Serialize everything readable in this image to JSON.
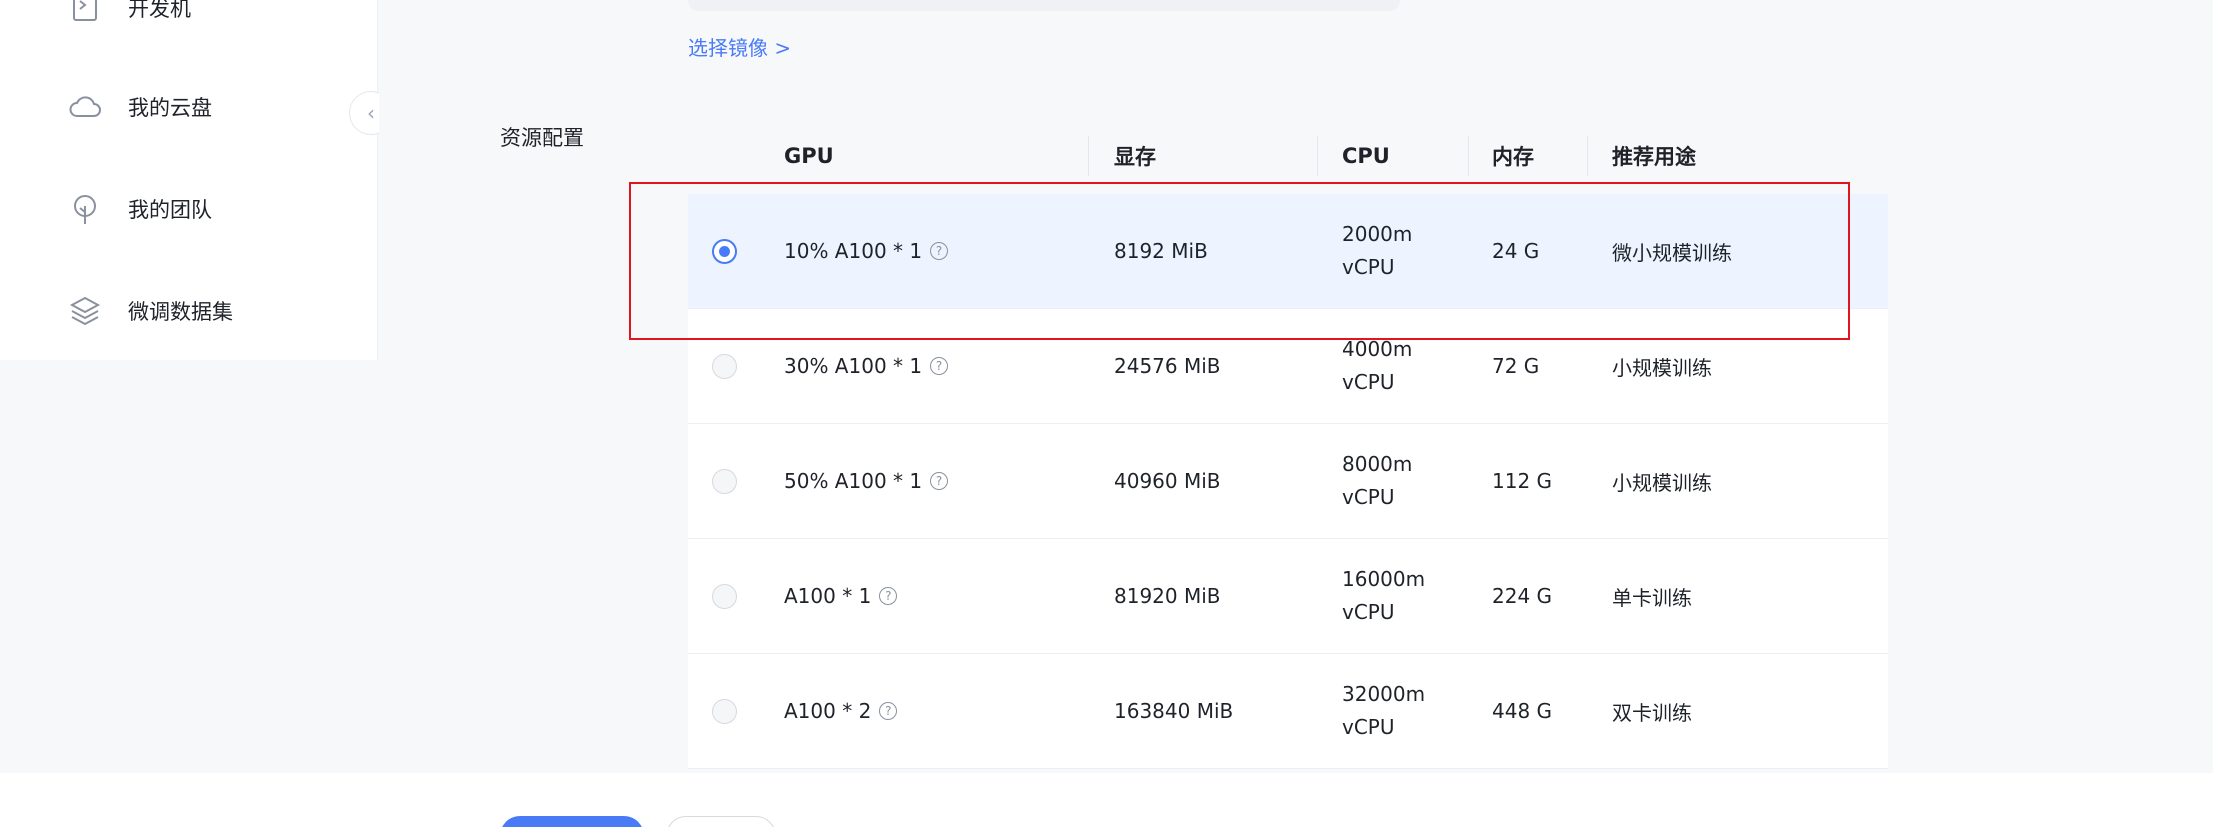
{
  "sidebar": {
    "items": [
      {
        "label": "开发机",
        "icon": "terminal-doc-icon"
      },
      {
        "label": "我的云盘",
        "icon": "cloud-icon"
      },
      {
        "label": "我的团队",
        "icon": "tree-icon"
      },
      {
        "label": "微调数据集",
        "icon": "layers-icon"
      }
    ],
    "collapse_icon": "chevron-left-icon"
  },
  "form": {
    "select_image_link": "选择镜像 >",
    "resource_label": "资源配置"
  },
  "resource_table": {
    "headers": {
      "gpu": "GPU",
      "vram": "显存",
      "cpu": "CPU",
      "memory": "内存",
      "usage": "推荐用途"
    },
    "rows": [
      {
        "gpu": "10% A100 * 1",
        "vram": "8192 MiB",
        "cpu": "2000m",
        "cpu_unit": "vCPU",
        "memory": "24 G",
        "usage": "微小规模训练",
        "selected": true
      },
      {
        "gpu": "30% A100 * 1",
        "vram": "24576 MiB",
        "cpu": "4000m",
        "cpu_unit": "vCPU",
        "memory": "72 G",
        "usage": "小规模训练",
        "selected": false
      },
      {
        "gpu": "50% A100 * 1",
        "vram": "40960 MiB",
        "cpu": "8000m",
        "cpu_unit": "vCPU",
        "memory": "112 G",
        "usage": "小规模训练",
        "selected": false
      },
      {
        "gpu": "A100 * 1",
        "vram": "81920 MiB",
        "cpu": "16000m",
        "cpu_unit": "vCPU",
        "memory": "224 G",
        "usage": "单卡训练",
        "selected": false
      },
      {
        "gpu": "A100 * 2",
        "vram": "163840 MiB",
        "cpu": "32000m",
        "cpu_unit": "vCPU",
        "memory": "448 G",
        "usage": "双卡训练",
        "selected": false
      }
    ]
  },
  "colors": {
    "accent": "#4a7bf7",
    "highlight_border": "#e0161e",
    "selected_row_bg": "#eef4ff"
  }
}
